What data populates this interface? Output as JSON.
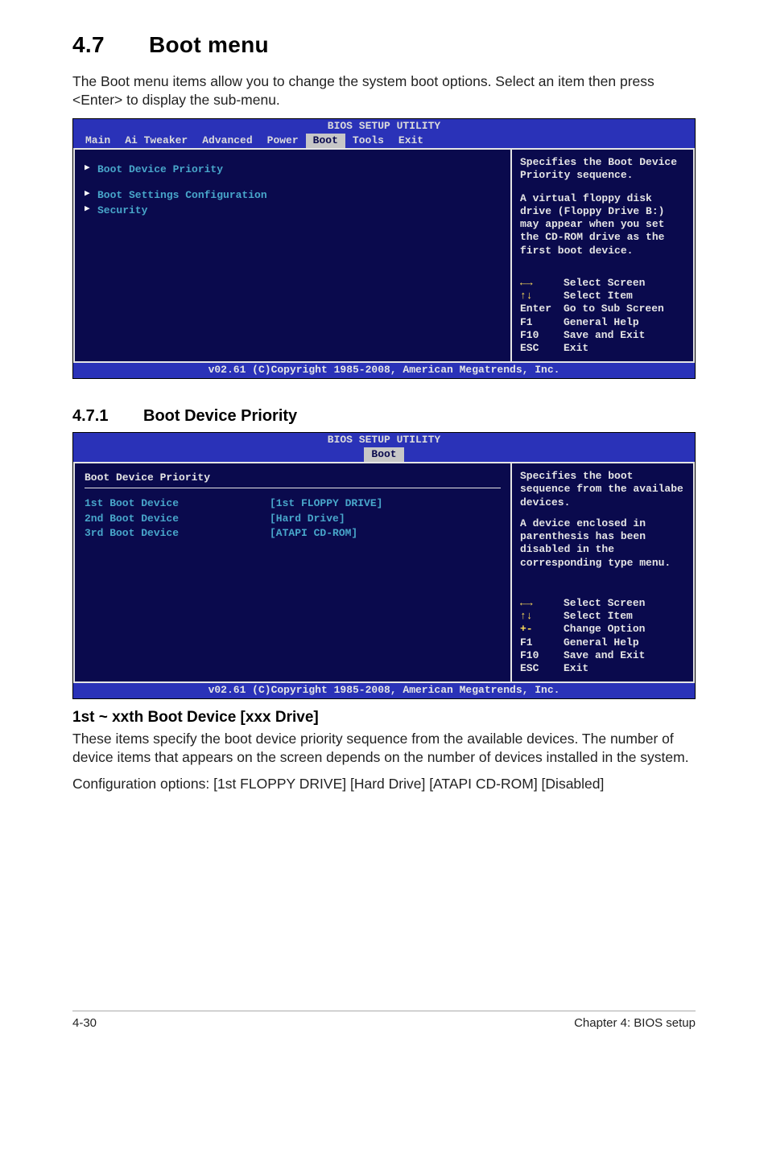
{
  "section": {
    "number": "4.7",
    "title": "Boot menu"
  },
  "intro": "The Boot menu items allow you to change the system boot options. Select an item then press <Enter> to display the sub-menu.",
  "bios1": {
    "header": "BIOS SETUP UTILITY",
    "tabs": [
      "Main",
      "Ai Tweaker",
      "Advanced",
      "Power",
      "Boot",
      "Tools",
      "Exit"
    ],
    "active_tab": "Boot",
    "items": [
      "Boot Device Priority",
      "Boot Settings Configuration",
      "Security"
    ],
    "help1": "Specifies the Boot Device Priority sequence.",
    "help2": "A virtual floppy disk drive (Floppy Drive B:) may appear when you set the CD-ROM drive as the first boot device.",
    "keys": [
      {
        "k": "←→",
        "d": "Select Screen",
        "sym": true
      },
      {
        "k": "↑↓",
        "d": "Select Item",
        "sym": true
      },
      {
        "k": "Enter",
        "d": "Go to Sub Screen",
        "sym": false
      },
      {
        "k": "F1",
        "d": "General Help",
        "sym": false
      },
      {
        "k": "F10",
        "d": "Save and Exit",
        "sym": false
      },
      {
        "k": "ESC",
        "d": "Exit",
        "sym": false
      }
    ],
    "footer": "v02.61 (C)Copyright 1985-2008, American Megatrends, Inc."
  },
  "subsection": {
    "number": "4.7.1",
    "title": "Boot Device Priority"
  },
  "bios2": {
    "header": "BIOS SETUP UTILITY",
    "tab": "Boot",
    "heading": "Boot Device Priority",
    "rows": [
      {
        "k": "1st Boot Device",
        "v": "[1st FLOPPY DRIVE]"
      },
      {
        "k": "2nd Boot Device",
        "v": "[Hard Drive]"
      },
      {
        "k": "3rd Boot Device",
        "v": "[ATAPI CD-ROM]"
      }
    ],
    "help1": "Specifies the boot sequence from the availabe devices.",
    "help2": "A device enclosed in parenthesis has been disabled in the corresponding type menu.",
    "keys": [
      {
        "k": "←→",
        "d": "Select Screen",
        "sym": true
      },
      {
        "k": "↑↓",
        "d": "Select Item",
        "sym": true
      },
      {
        "k": "+-",
        "d": "Change Option",
        "sym": true
      },
      {
        "k": "F1",
        "d": "General Help",
        "sym": false
      },
      {
        "k": "F10",
        "d": "Save and Exit",
        "sym": false
      },
      {
        "k": "ESC",
        "d": "Exit",
        "sym": false
      }
    ],
    "footer": "v02.61 (C)Copyright 1985-2008, American Megatrends, Inc."
  },
  "item_heading": "1st ~ xxth Boot Device [xxx Drive]",
  "item_p1": "These items specify the boot device priority sequence from the available devices. The number of device items that appears on the screen depends on the number of devices installed in the system.",
  "item_p2": "Configuration options: [1st FLOPPY DRIVE] [Hard Drive] [ATAPI CD-ROM] [Disabled]",
  "footer": {
    "left": "4-30",
    "right": "Chapter 4: BIOS setup"
  }
}
